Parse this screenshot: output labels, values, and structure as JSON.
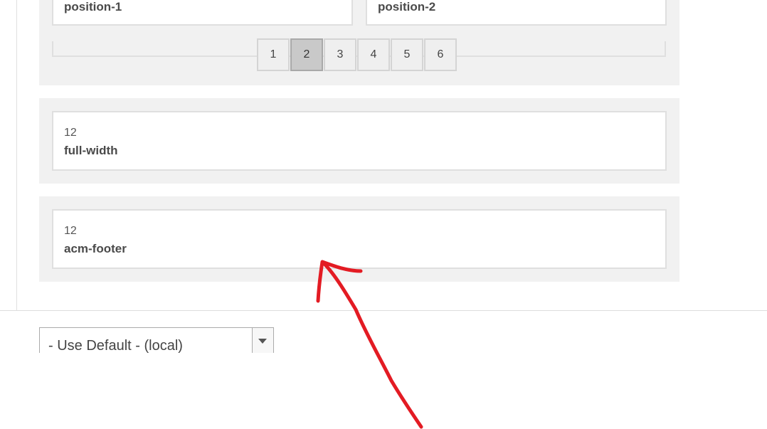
{
  "layout_rows": {
    "top": {
      "columns": [
        {
          "name": "position-1"
        },
        {
          "name": "position-2"
        }
      ],
      "pagination": {
        "pages": [
          "1",
          "2",
          "3",
          "4",
          "5",
          "6"
        ],
        "current_page": "2"
      }
    },
    "middle": {
      "column": {
        "size": "12",
        "name": "full-width"
      }
    },
    "bottom": {
      "column": {
        "size": "12",
        "name": "acm-footer"
      }
    }
  },
  "layout_select": {
    "value": "- Use Default - (local)",
    "arrow_icon": "caret-down-icon"
  },
  "annotation": {
    "icon": "red-arrow-icon",
    "color": "#e31b23"
  }
}
